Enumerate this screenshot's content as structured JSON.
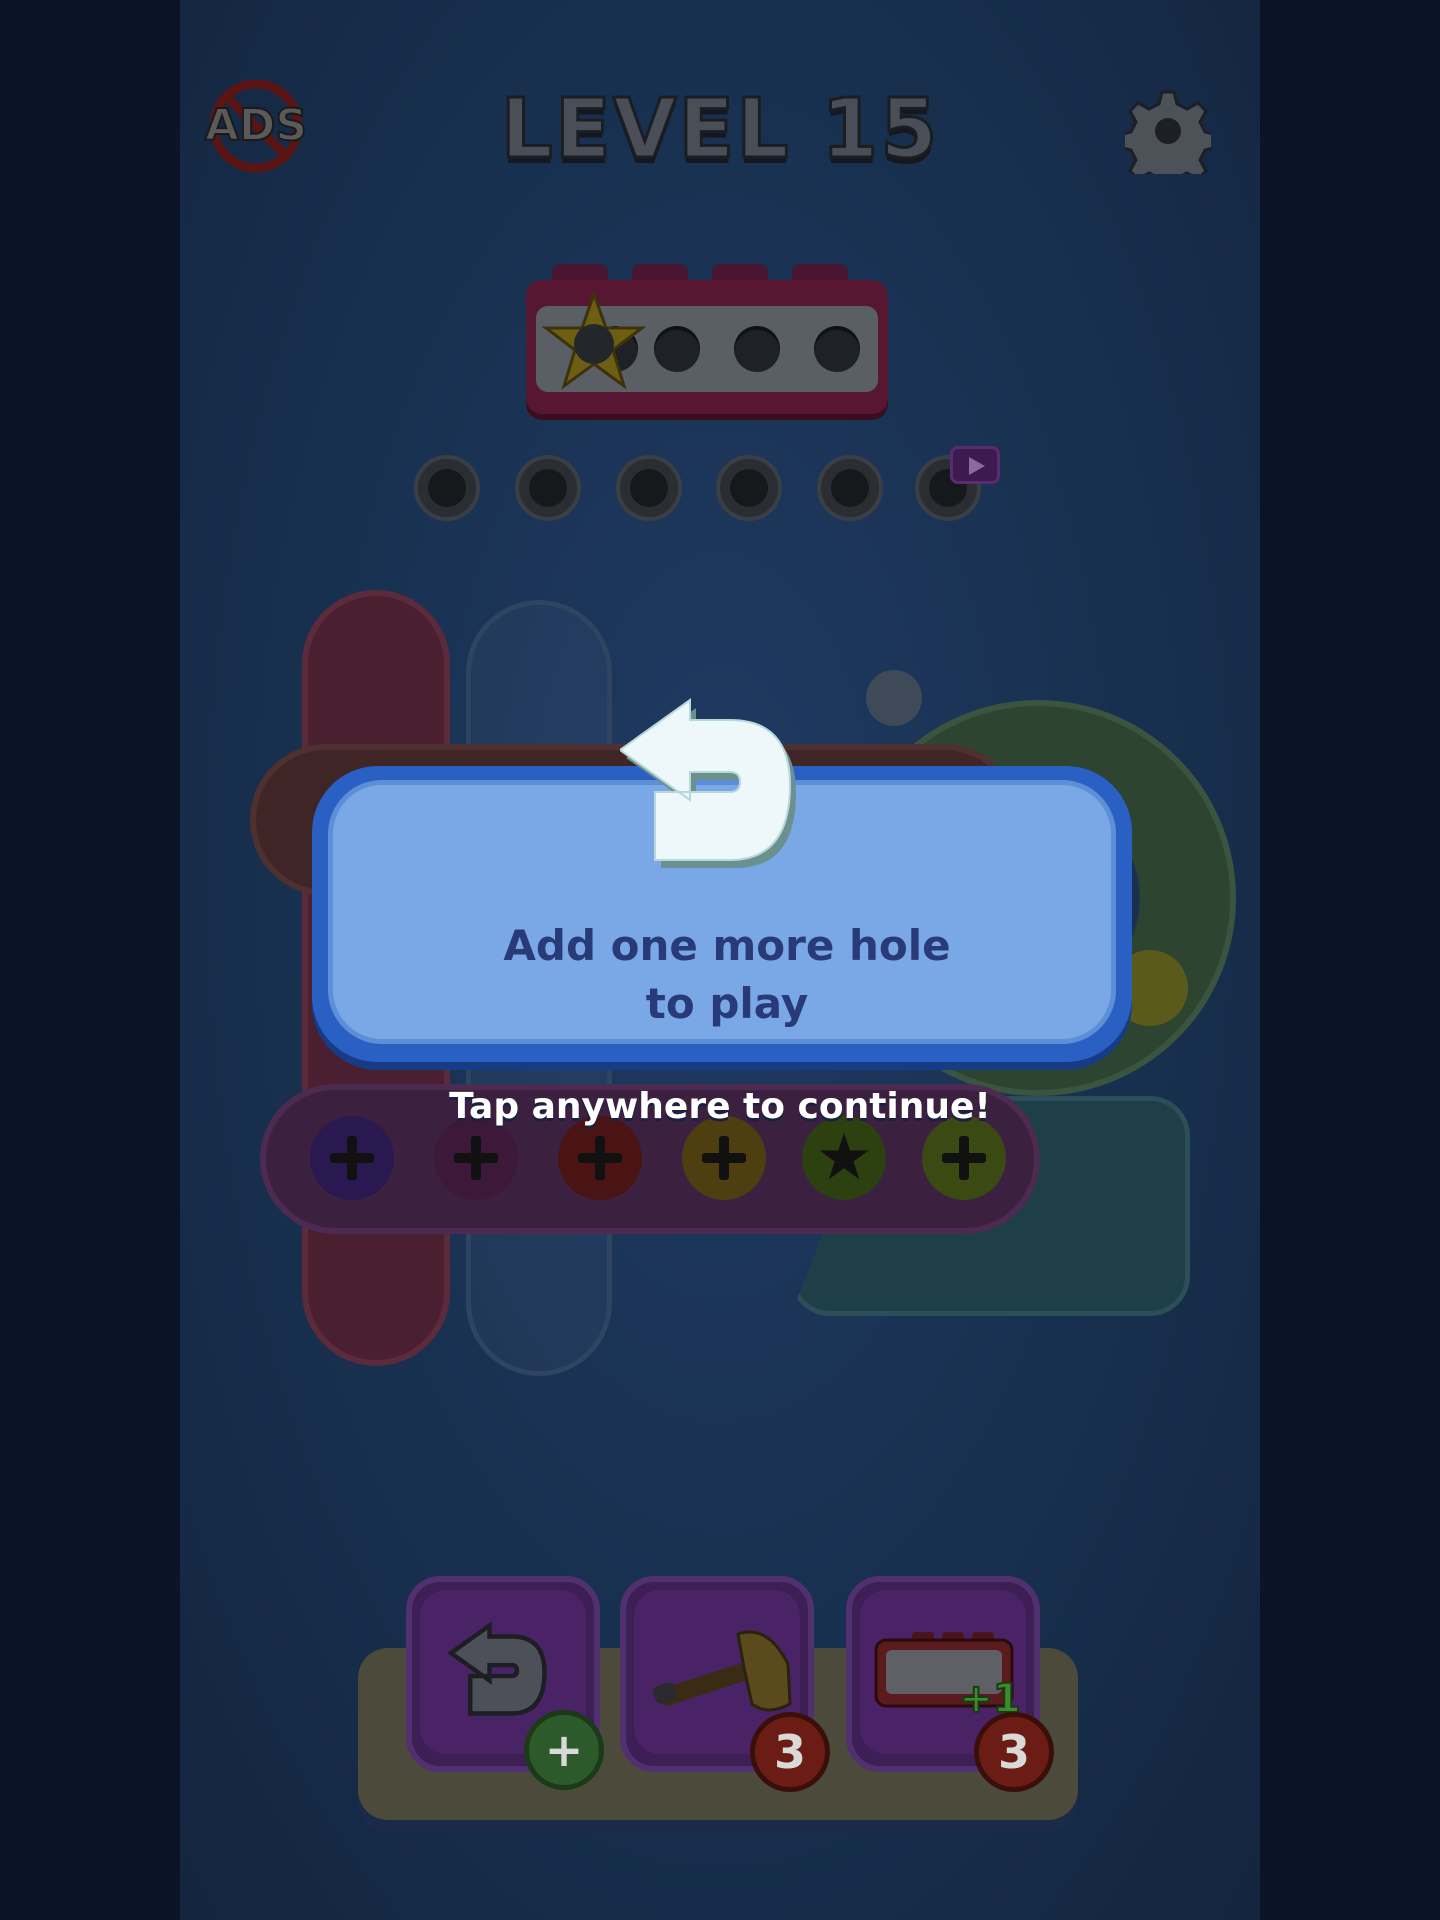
{
  "header": {
    "level_title": "LEVEL 15",
    "no_ads_label": "ADS"
  },
  "popup": {
    "message": "Add one more hole to play",
    "continue_hint": "Tap anywhere to continue!"
  },
  "toolbar": {
    "undo_badge": "+",
    "hammer_count": "3",
    "add_hole_count": "3",
    "add_hole_overlay": "+1"
  },
  "colors": {
    "popup_border": "#2a5fc4",
    "popup_fill": "#7aa8e6",
    "popup_text": "#283a78",
    "tool_bg": "#4a2366",
    "badge_red": "#6b1c14",
    "badge_green": "#2d5a2a"
  },
  "icons": {
    "no_ads": "no-ads-icon",
    "settings": "gear-icon",
    "undo": "undo-arrow-icon",
    "hammer": "hammer-icon",
    "add_hole": "hole-box-plus-icon",
    "star_bolt": "star-icon",
    "video": "video-play-icon"
  }
}
